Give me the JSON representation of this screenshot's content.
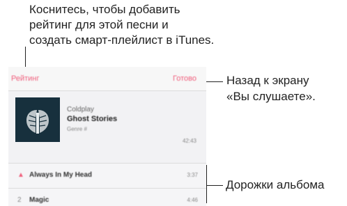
{
  "callouts": {
    "rating_line1": "Коснитесь, чтобы добавить",
    "rating_line2": "рейтинг для этой песни и",
    "rating_line3": "создать смарт-плейлист в iTunes.",
    "back_line1": "Назад к экрану",
    "back_line2": "«Вы слушаете».",
    "tracks": "Дорожки альбома"
  },
  "navbar": {
    "rating_label": "Рейтинг",
    "done_label": "Готово"
  },
  "album": {
    "artist": "Coldplay",
    "title": "Ghost Stories",
    "genre": "Genre #",
    "total_time": "42:43"
  },
  "tracks": [
    {
      "number": "▲",
      "title": "Always In My Head",
      "duration": "3:37"
    },
    {
      "number": "2",
      "title": "Magic",
      "duration": "4:46"
    }
  ],
  "colors": {
    "accent": "#f0607d",
    "artwork_bg": "#17303d"
  },
  "icons": {
    "now_playing": "speaker-icon",
    "artwork": "wings-artwork"
  }
}
